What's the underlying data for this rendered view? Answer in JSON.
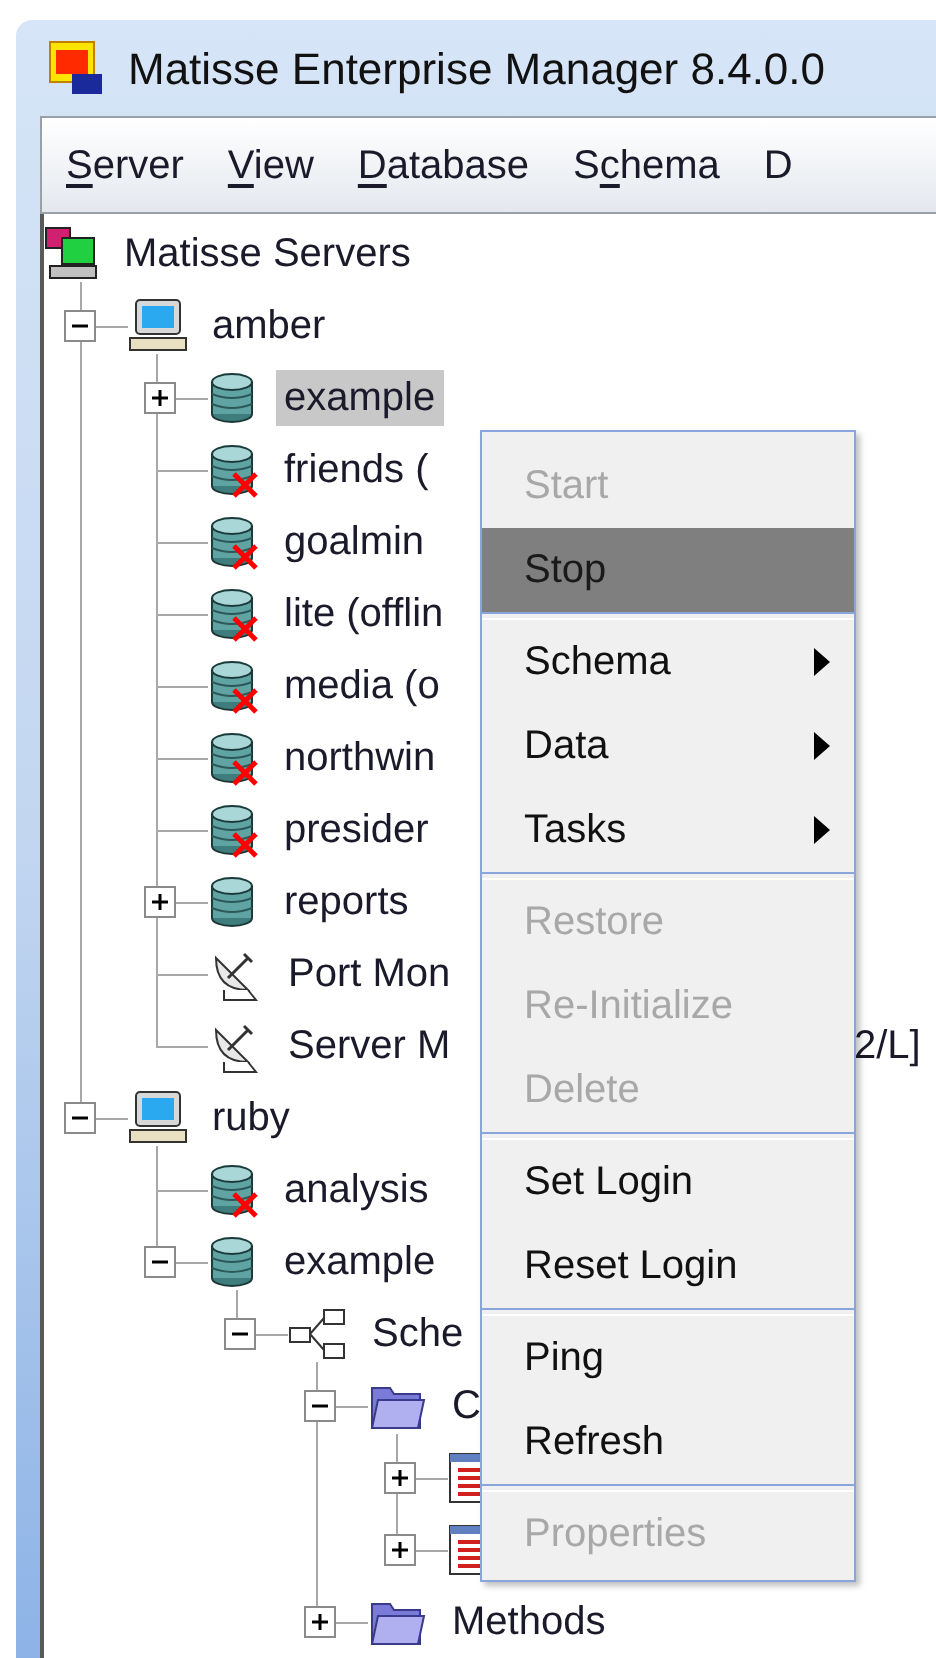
{
  "window": {
    "title": "Matisse Enterprise Manager 8.4.0.0"
  },
  "menu_bar": [
    {
      "parts": [
        {
          "text": "S",
          "underlined": true
        },
        {
          "text": "erver",
          "underlined": false
        }
      ]
    },
    {
      "parts": [
        {
          "text": "V",
          "underlined": true
        },
        {
          "text": "iew",
          "underlined": false
        }
      ]
    },
    {
      "parts": [
        {
          "text": "D",
          "underlined": true
        },
        {
          "text": "atabase",
          "underlined": false
        }
      ]
    },
    {
      "parts": [
        {
          "text": "S",
          "underlined": false
        },
        {
          "text": "c",
          "underlined": true
        },
        {
          "text": "hema",
          "underlined": false
        }
      ]
    },
    {
      "parts": [
        {
          "text": "D",
          "underlined": false
        }
      ]
    }
  ],
  "tree": {
    "label": "Matisse Servers",
    "kind": "servers",
    "selected": false,
    "children": [
      {
        "label": "amber",
        "kind": "host",
        "expanded": true,
        "selected": false,
        "children": [
          {
            "label": "example",
            "kind": "database",
            "expanded": false,
            "selected": true
          },
          {
            "label": "friends (",
            "kind": "database-offline",
            "selected": false
          },
          {
            "label": "goalmin",
            "kind": "database-offline",
            "selected": false
          },
          {
            "label": "lite (offlin",
            "kind": "database-offline",
            "selected": false
          },
          {
            "label": "media (o",
            "kind": "database-offline",
            "selected": false
          },
          {
            "label": "northwin",
            "kind": "database-offline",
            "selected": false
          },
          {
            "label": "presider",
            "kind": "database-offline",
            "selected": false
          },
          {
            "label": "reports",
            "kind": "database",
            "expanded": false,
            "selected": false
          },
          {
            "label": "Port Mon",
            "kind": "monitor",
            "selected": false
          },
          {
            "label": "Server M",
            "kind": "monitor",
            "selected": false,
            "tail": "2/L]"
          }
        ]
      },
      {
        "label": "ruby",
        "kind": "host",
        "expanded": true,
        "selected": false,
        "children": [
          {
            "label": "analysis",
            "kind": "database-offline",
            "selected": false
          },
          {
            "label": "example",
            "kind": "database",
            "expanded": true,
            "selected": false,
            "children": [
              {
                "label": "Sche",
                "kind": "schema",
                "expanded": true,
                "selected": false,
                "children": [
                  {
                    "label": "C",
                    "kind": "folder",
                    "expanded": true,
                    "selected": false,
                    "children": [
                      {
                        "kind": "class",
                        "expanded": false
                      },
                      {
                        "kind": "class",
                        "expanded": false
                      }
                    ]
                  },
                  {
                    "label": "Methods",
                    "kind": "folder",
                    "expanded": false,
                    "selected": false
                  }
                ]
              }
            ]
          }
        ]
      }
    ]
  },
  "context_menu": {
    "items": [
      {
        "kind": "item",
        "label": "Start",
        "disabled": true,
        "selected": false,
        "submenu": false
      },
      {
        "kind": "item",
        "label": "Stop",
        "disabled": false,
        "selected": true,
        "submenu": false
      },
      {
        "kind": "separator"
      },
      {
        "kind": "item",
        "label": "Schema",
        "disabled": false,
        "selected": false,
        "submenu": true
      },
      {
        "kind": "item",
        "label": "Data",
        "disabled": false,
        "selected": false,
        "submenu": true
      },
      {
        "kind": "item",
        "label": "Tasks",
        "disabled": false,
        "selected": false,
        "submenu": true
      },
      {
        "kind": "separator"
      },
      {
        "kind": "item",
        "label": "Restore",
        "disabled": true,
        "selected": false,
        "submenu": false
      },
      {
        "kind": "item",
        "label": "Re-Initialize",
        "disabled": true,
        "selected": false,
        "submenu": false
      },
      {
        "kind": "item",
        "label": "Delete",
        "disabled": true,
        "selected": false,
        "submenu": false
      },
      {
        "kind": "separator"
      },
      {
        "kind": "item",
        "label": "Set Login",
        "disabled": false,
        "selected": false,
        "submenu": false
      },
      {
        "kind": "item",
        "label": "Reset Login",
        "disabled": false,
        "selected": false,
        "submenu": false
      },
      {
        "kind": "separator"
      },
      {
        "kind": "item",
        "label": "Ping",
        "disabled": false,
        "selected": false,
        "submenu": false
      },
      {
        "kind": "item",
        "label": "Refresh",
        "disabled": false,
        "selected": false,
        "submenu": false
      },
      {
        "kind": "separator"
      },
      {
        "kind": "item",
        "label": "Properties",
        "disabled": true,
        "selected": false,
        "submenu": false
      }
    ]
  }
}
